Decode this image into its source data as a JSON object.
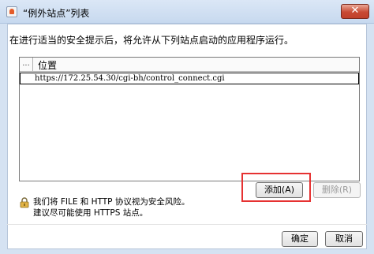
{
  "window": {
    "title": "“例外站点”列表",
    "close_label": "✕"
  },
  "info_text": "在进行适当的安全提示后，将允许从下列站点启动的应用程序运行。",
  "list": {
    "columns": [
      "...",
      "位置"
    ],
    "rows": [
      "https://172.25.54.30/cgi-bh/control_connect.cgi"
    ]
  },
  "buttons": {
    "add": "添加(A)",
    "delete": "删除(R)",
    "ok": "确定",
    "cancel": "取消"
  },
  "warning": {
    "line1": "我们将 FILE 和 HTTP 协议视为安全风险。",
    "line2": "建议尽可能使用 HTTPS 站点。"
  },
  "icons": {
    "title": "java-cup-icon",
    "lock": "padlock-icon",
    "close": "close-icon"
  },
  "colors": {
    "highlight": "#e63232",
    "close_button": "#c84a33"
  }
}
